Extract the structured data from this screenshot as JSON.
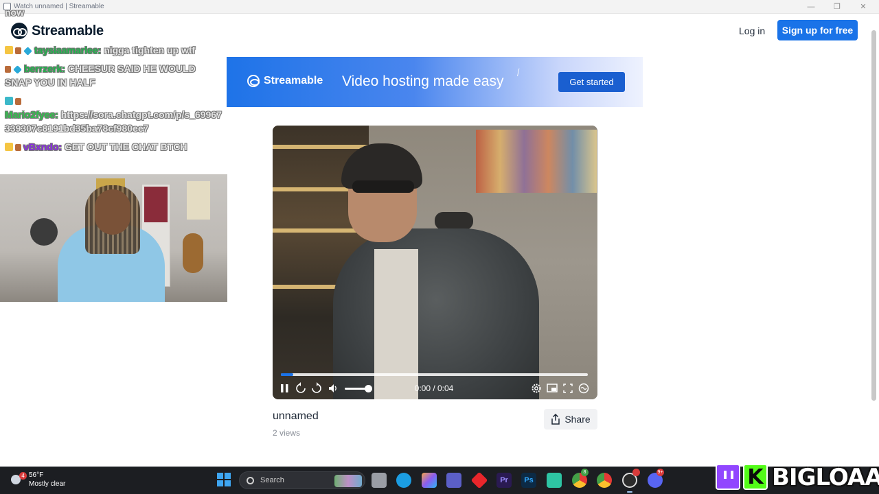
{
  "window": {
    "title": "Watch unnamed | Streamable",
    "controls": [
      "—",
      "❐",
      "✕"
    ]
  },
  "header": {
    "brand": "Streamable",
    "login": "Log in",
    "signup": "Sign up for free"
  },
  "banner": {
    "logo_text": "Streamable",
    "tagline": "Video hosting made easy",
    "cta": "Get started",
    "colors": {
      "start": "#1e73e8",
      "end": "#eef2fe"
    }
  },
  "video": {
    "title": "unnamed",
    "views": "2 views",
    "time": "0:00 / 0:04",
    "progress": 0.04,
    "volume": 0.85,
    "share": "Share"
  },
  "chat": {
    "lines": [
      {
        "user": "",
        "text": "now",
        "color": "#e7e7e7"
      },
      {
        "user": "taysiaamarlee:",
        "text": "nigga tighten up wtf",
        "color": "#1fb24a"
      },
      {
        "user": "berrzerk:",
        "text": "CHEESUR SAID HE WOULD SNAP YOU IN HALF",
        "color": "#1fb24a"
      },
      {
        "user": "Mario2fyee:",
        "text": "https://sora.chatgpt.com/p/s_69967339307c8191bd35ba78cf980ee7",
        "color": "#2fc04a"
      },
      {
        "user": "vBxndo:",
        "text": "GET OUT THE CHAT BTCH",
        "color": "#8a2be2"
      }
    ]
  },
  "taskbar": {
    "weather_temp": "56°F",
    "weather_desc": "Mostly clear",
    "weather_badge": "4",
    "search": "Search",
    "apps": [
      "file-explorer-icon",
      "edge-icon",
      "copilot-icon",
      "teams-icon",
      "vs-icon",
      "premiere-icon",
      "photoshop-icon",
      "obs-mini-icon",
      "chrome-canary-icon",
      "chrome-icon",
      "obs-icon",
      "discord-icon"
    ]
  },
  "stream_logo": {
    "kick": "K",
    "name": "BIGLOAAF"
  }
}
